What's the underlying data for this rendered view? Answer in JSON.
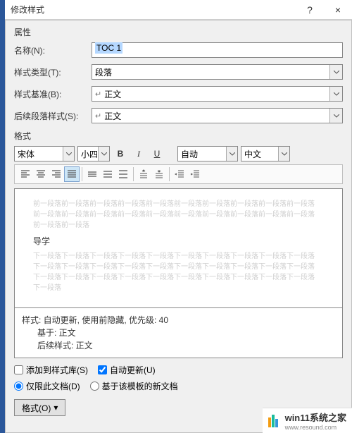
{
  "titlebar": {
    "title": "修改样式",
    "help": "?",
    "close": "×"
  },
  "section_props": "属性",
  "rows": {
    "name_label": "名称(N):",
    "name_value": "TOC 1",
    "type_label": "样式类型(T):",
    "type_value": "段落",
    "base_label": "样式基准(B):",
    "base_value": "正文",
    "follow_label": "后续段落样式(S):",
    "follow_value": "正文"
  },
  "section_format": "格式",
  "toolbar": {
    "font": "宋体",
    "size": "小四",
    "bold": "B",
    "italic": "I",
    "underline": "U",
    "color_label": "自动",
    "lang": "中文"
  },
  "preview": {
    "gray_before": "前一段落前一段落前一段落前一段落前一段落前一段落前一段落前一段落前一段落前一段落",
    "gray_before2": "前一段落前一段落前一段落前一段落前一段落前一段落前一段落前一段落前一段落前一段落",
    "gray_before3": "前一段落前一段落",
    "main": "导学",
    "gray_after": "下一段落下一段落下一段落下一段落下一段落下一段落下一段落下一段落下一段落下一段落",
    "gray_after2": "下一段落下一段落下一段落下一段落下一段落下一段落下一段落下一段落下一段落下一段落",
    "gray_after3": "下一段落下一段落下一段落下一段落下一段落下一段落下一段落下一段落下一段落下一段落",
    "gray_after4": "下一段落"
  },
  "info": {
    "line1": "样式: 自动更新, 使用前隐藏, 优先级: 40",
    "line2": "基于: 正文",
    "line3": "后续样式: 正文"
  },
  "checks": {
    "add_gallery": "添加到样式库(S)",
    "auto_update": "自动更新(U)"
  },
  "radios": {
    "this_doc": "仅限此文档(D)",
    "new_docs": "基于该模板的新文档"
  },
  "format_btn": "格式(O)",
  "watermark": {
    "text": "win11系统之家",
    "sub": "www.resound.com"
  }
}
